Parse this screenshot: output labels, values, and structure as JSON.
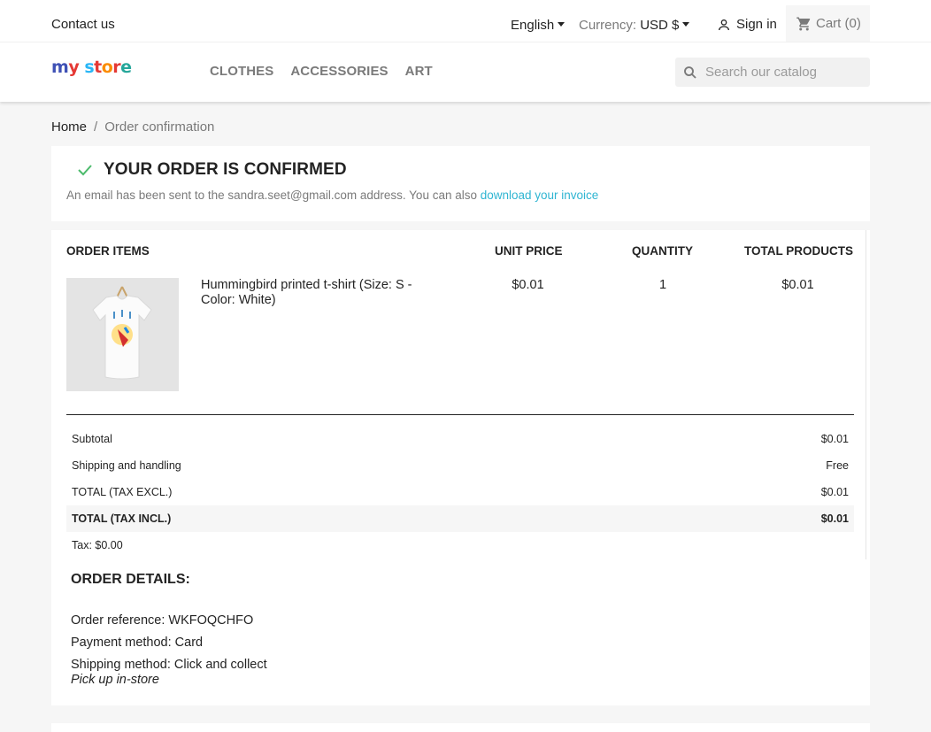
{
  "topbar": {
    "contact": "Contact us",
    "language": "English",
    "currency_label": "Currency:",
    "currency_value": "USD $",
    "sign_in": "Sign in",
    "cart": "Cart (0)"
  },
  "header": {
    "logo": [
      "m",
      "y",
      " ",
      "s",
      "t",
      "o",
      "r",
      "e"
    ],
    "logo_colors": [
      "#3f51b5",
      "#e53935",
      "#ffffff",
      "#29b6f6",
      "#e53935",
      "#fb8c00",
      "#e53935",
      "#26a69a"
    ],
    "nav": [
      "CLOTHES",
      "ACCESSORIES",
      "ART"
    ],
    "search_placeholder": "Search our catalog"
  },
  "breadcrumb": {
    "home": "Home",
    "separator": "/",
    "current": "Order confirmation"
  },
  "confirmation": {
    "title": "YOUR ORDER IS CONFIRMED",
    "text": "An email has been sent to the sandra.seet@gmail.com address. You can also ",
    "link": "download your invoice"
  },
  "order": {
    "columns": [
      "ORDER ITEMS",
      "UNIT PRICE",
      "QUANTITY",
      "TOTAL PRODUCTS"
    ],
    "item": {
      "name": "Hummingbird printed t-shirt (Size: S - Color: White)",
      "unit_price": "$0.01",
      "quantity": "1",
      "total": "$0.01"
    },
    "totals": [
      {
        "label": "Subtotal",
        "value": "$0.01"
      },
      {
        "label": "Shipping and handling",
        "value": "Free"
      },
      {
        "label": "TOTAL (TAX EXCL.)",
        "value": "$0.01"
      },
      {
        "label": "TOTAL (TAX INCL.)",
        "value": "$0.01"
      },
      {
        "label": "Tax: $0.00",
        "value": ""
      }
    ]
  },
  "details": {
    "title": "ORDER DETAILS:",
    "reference": "Order reference: WKFOQCHFO",
    "payment": "Payment method: Card",
    "shipping": "Shipping method: Click and collect",
    "pickup": "Pick up in-store"
  },
  "colors": {
    "accent": "#2fb5d2",
    "check": "#4cbb6c"
  }
}
